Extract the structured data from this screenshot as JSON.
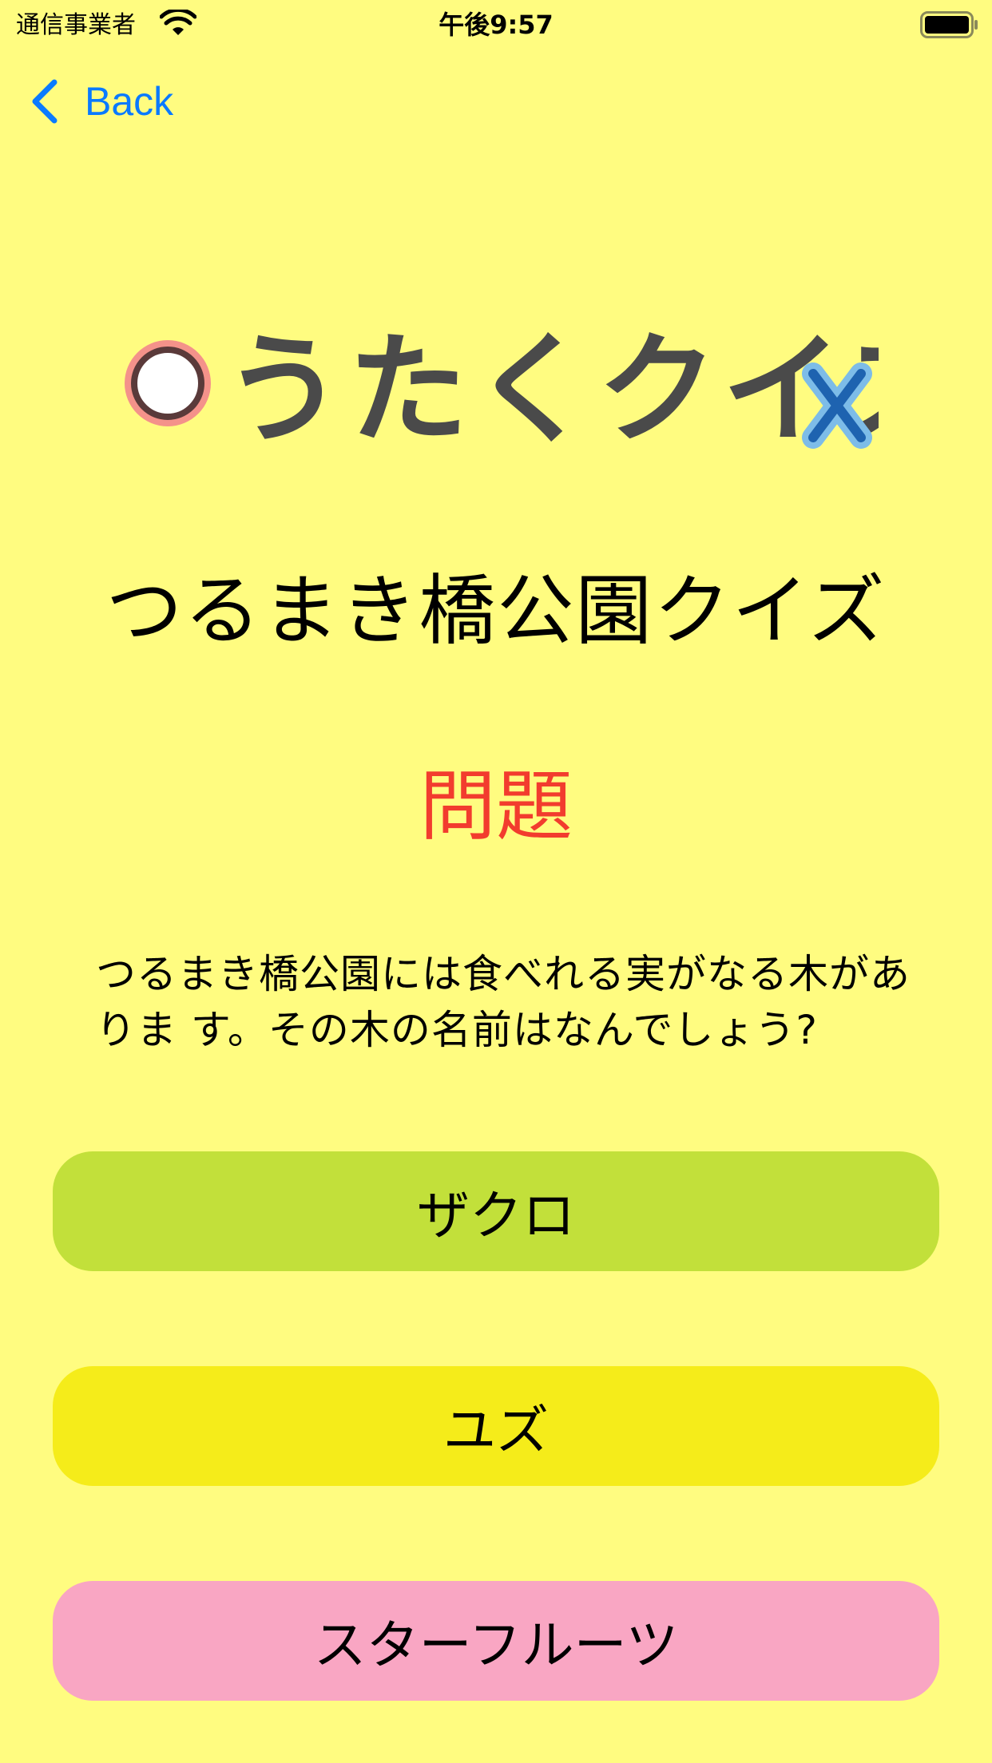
{
  "status_bar": {
    "carrier": "通信事業者",
    "time": "午後9:57"
  },
  "nav": {
    "back_label": "Back"
  },
  "logo": {
    "text": "うたくクイズ"
  },
  "quiz": {
    "title": "つるまき橋公園クイズ",
    "question_heading": "問題",
    "question_text": "つるまき橋公園には食べれる実がなる木がありま す。その木の名前はなんでしょう?"
  },
  "choices": [
    {
      "label": "ザクロ",
      "color": "#C2E03A"
    },
    {
      "label": "ユズ",
      "color": "#F5EC1A"
    },
    {
      "label": "スターフルーツ",
      "color": "#F9A6C3"
    }
  ],
  "colors": {
    "background": "#FFFC80",
    "accent": "#0A7AFF",
    "question_heading": "#F23C2E"
  }
}
